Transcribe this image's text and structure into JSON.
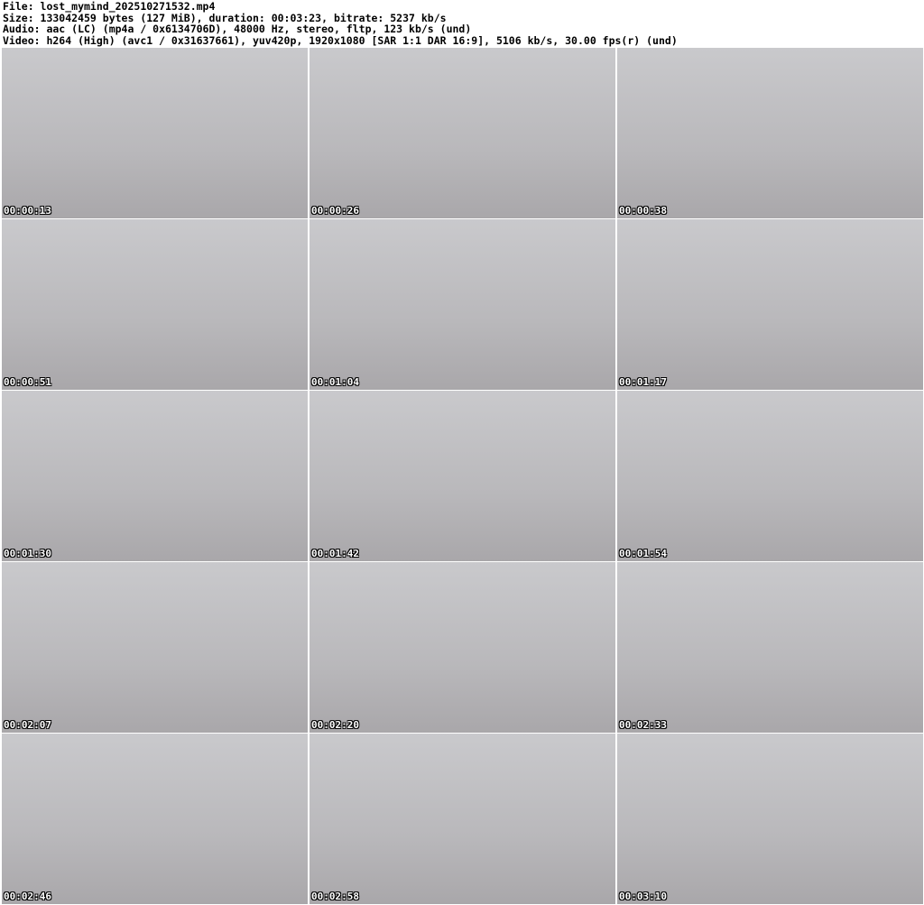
{
  "header": {
    "file": "File: lost_mymind_202510271532.mp4",
    "size": "Size: 133042459 bytes (127 MiB), duration: 00:03:23, bitrate: 5237 kb/s",
    "audio": "Audio: aac (LC) (mp4a / 0x6134706D), 48000 Hz, stereo, fltp, 123 kb/s (und)",
    "video": "Video: h264 (High) (avc1 / 0x31637661), yuv420p, 1920x1080 [SAR 1:1 DAR 16:9], 5106 kb/s, 30.00 fps(r) (und)"
  },
  "thumbnails": [
    {
      "time": "00:00:13"
    },
    {
      "time": "00:00:26"
    },
    {
      "time": "00:00:38"
    },
    {
      "time": "00:00:51"
    },
    {
      "time": "00:01:04"
    },
    {
      "time": "00:01:17"
    },
    {
      "time": "00:01:30"
    },
    {
      "time": "00:01:42"
    },
    {
      "time": "00:01:54"
    },
    {
      "time": "00:02:07"
    },
    {
      "time": "00:02:20"
    },
    {
      "time": "00:02:33"
    },
    {
      "time": "00:02:46"
    },
    {
      "time": "00:02:58"
    },
    {
      "time": "00:03:10"
    }
  ]
}
